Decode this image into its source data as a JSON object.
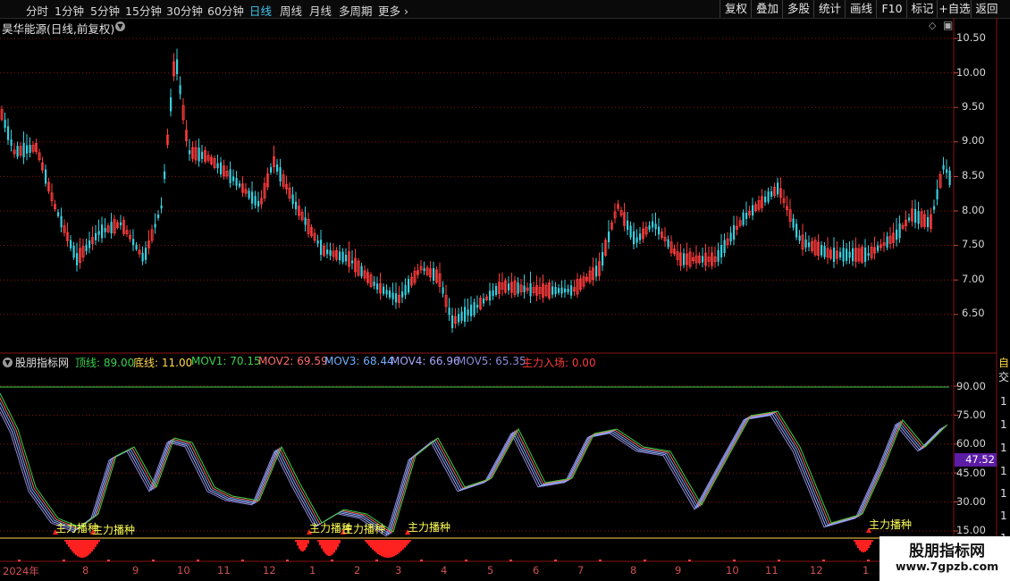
{
  "toolbar": {
    "periods": [
      "分时",
      "1分钟",
      "5分钟",
      "15分钟",
      "30分钟",
      "60分钟",
      "日线",
      "周线",
      "月线",
      "多周期",
      "更多"
    ],
    "active_period": "日线",
    "buttons": [
      "复权",
      "叠加",
      "多股",
      "统计",
      "画线",
      "F10",
      "标记",
      "+自选",
      "返回"
    ]
  },
  "stock": {
    "title": "昊华能源(日线,前复权)"
  },
  "indicator": {
    "name": "股朋指标网",
    "values": [
      {
        "label": "顶线: 89.00",
        "color": "#3bd14a"
      },
      {
        "label": "底线: 11.00",
        "color": "#ffd84a"
      },
      {
        "label": "MOV1: 70.15",
        "color": "#3bd14a"
      },
      {
        "label": "MOV2: 69.59",
        "color": "#ff6a6a"
      },
      {
        "label": "MOV3: 68.44",
        "color": "#6fb0ff"
      },
      {
        "label": "MOV4: 66.96",
        "color": "#a6a6ff"
      },
      {
        "label": "MOV5: 65.35",
        "color": "#8a8ad8"
      },
      {
        "label": "主力入场: 0.00",
        "color": "#ff3a3a"
      }
    ],
    "current_value": "47.52",
    "signal_text": "主力播种"
  },
  "price_axis": [
    "10.50",
    "10.00",
    "9.50",
    "9.00",
    "8.50",
    "8.00",
    "7.50",
    "7.00",
    "6.50"
  ],
  "indicator_axis": [
    "90.00",
    "75.00",
    "60.00",
    "45.00",
    "30.00",
    "15.00"
  ],
  "date_axis": [
    "2024年",
    "8",
    "9",
    "10",
    "11",
    "12",
    "1",
    "2",
    "3",
    "4",
    "5",
    "6",
    "7",
    "8",
    "9",
    "10",
    "11",
    "12",
    "1"
  ],
  "right_strip": [
    "自",
    "交",
    "1",
    "1",
    "1",
    "1",
    "1",
    "1",
    "1",
    "1"
  ],
  "watermark": {
    "name": "股朋指标网",
    "url": "www.7gpzb.com"
  },
  "colors": {
    "up": "#ff3c3c",
    "down": "#36d0e0",
    "active": "#3fc6f0",
    "grid": "#8a1515"
  }
}
